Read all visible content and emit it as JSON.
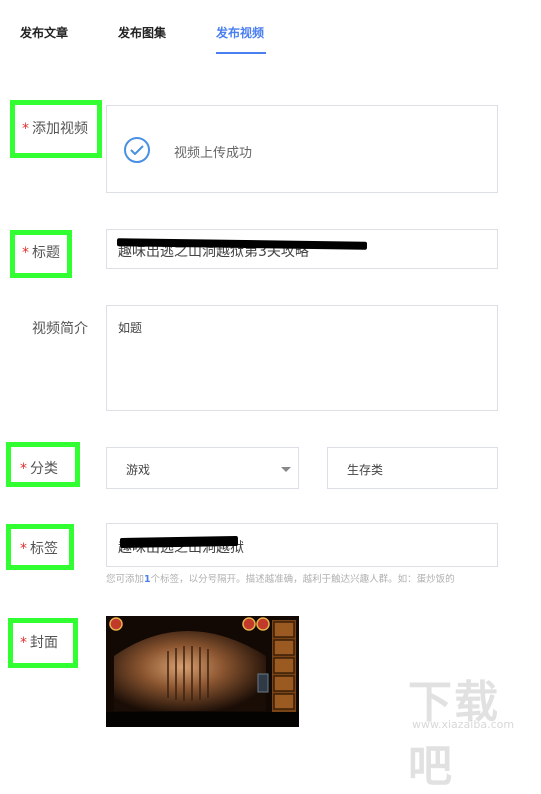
{
  "tabs": [
    {
      "label": "发布文章"
    },
    {
      "label": "发布图集"
    },
    {
      "label": "发布视频",
      "active": true
    }
  ],
  "form": {
    "required_mark": "*",
    "video": {
      "label": "添加视频",
      "status": "视频上传成功",
      "icon": "check-circle-icon"
    },
    "title": {
      "label": "标题",
      "value": "趣味出逃之山洞越狱第3关攻略"
    },
    "description": {
      "label": "视频简介",
      "value": "如题"
    },
    "category": {
      "label": "分类",
      "primary": "游戏",
      "secondary": "生存类"
    },
    "tags": {
      "label": "标签",
      "value": "趣味出逃之山洞越狱",
      "hint_prefix": "您可添加",
      "hint_count": "1",
      "hint_suffix": "个标签，以分号隔开。描述越准确，越利于触达兴趣人群。如：蛋炒饭的"
    },
    "cover": {
      "label": "封面"
    }
  },
  "watermark": {
    "text": "下载吧",
    "url": "www.xiazaiba.com"
  },
  "colors": {
    "accent": "#4a7ff0",
    "required": "#e0302d",
    "highlight": "#32ff32",
    "border": "#dcdfe6"
  }
}
